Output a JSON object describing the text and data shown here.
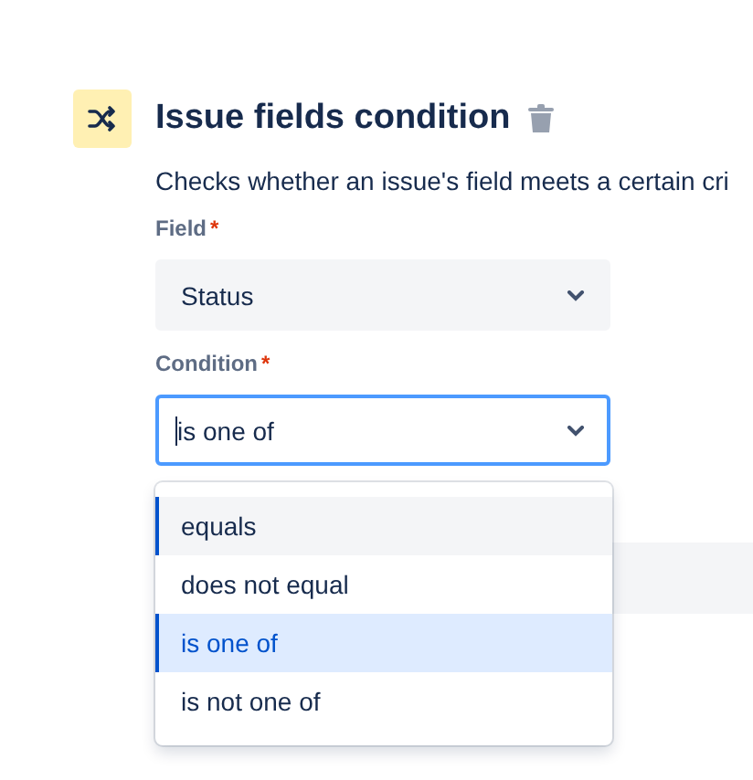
{
  "header": {
    "title": "Issue fields condition",
    "description": "Checks whether an issue's field meets a certain cri"
  },
  "fields": [
    {
      "label": "Field",
      "required_mark": "*",
      "value": "Status",
      "focused": false
    },
    {
      "label": "Condition",
      "required_mark": "*",
      "value": "is one of",
      "focused": true
    }
  ],
  "dropdown": {
    "options": [
      {
        "label": "equals",
        "selected": false,
        "hovered": true
      },
      {
        "label": "does not equal",
        "selected": false,
        "hovered": false
      },
      {
        "label": "is one of",
        "selected": true,
        "hovered": false
      },
      {
        "label": "is not one of",
        "selected": false,
        "hovered": false
      }
    ]
  }
}
